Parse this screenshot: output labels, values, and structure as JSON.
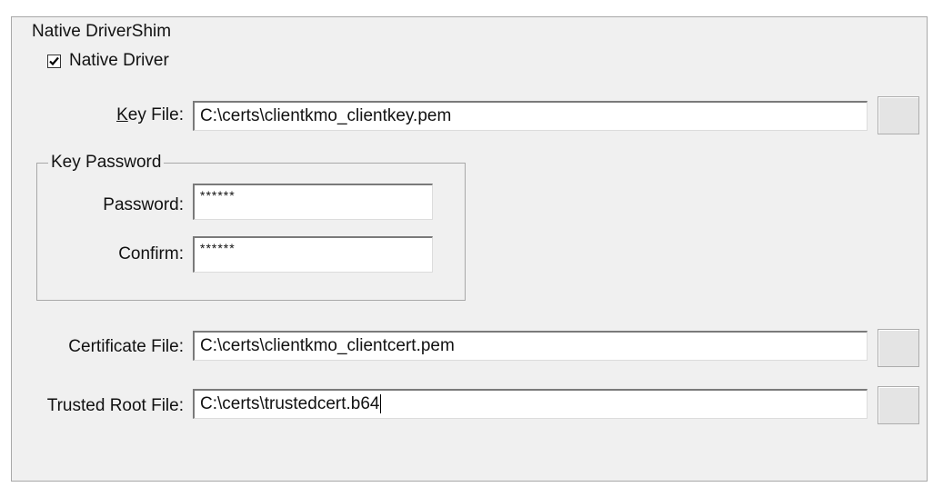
{
  "group": {
    "title": "Native DriverShim"
  },
  "native_driver": {
    "label": "Native Driver",
    "checked": true
  },
  "key_file": {
    "label_accel": "K",
    "label_rest": "ey File:",
    "value": "C:\\certs\\clientkmo_clientkey.pem"
  },
  "key_password": {
    "title": "Key Password",
    "password_label": "Password:",
    "password_value": "******",
    "confirm_label": "Confirm:",
    "confirm_value": "******"
  },
  "certificate_file": {
    "label": "Certificate File:",
    "value": "C:\\certs\\clientkmo_clientcert.pem"
  },
  "trusted_root_file": {
    "label": "Trusted Root File:",
    "value": "C:\\certs\\trustedcert.b64"
  }
}
